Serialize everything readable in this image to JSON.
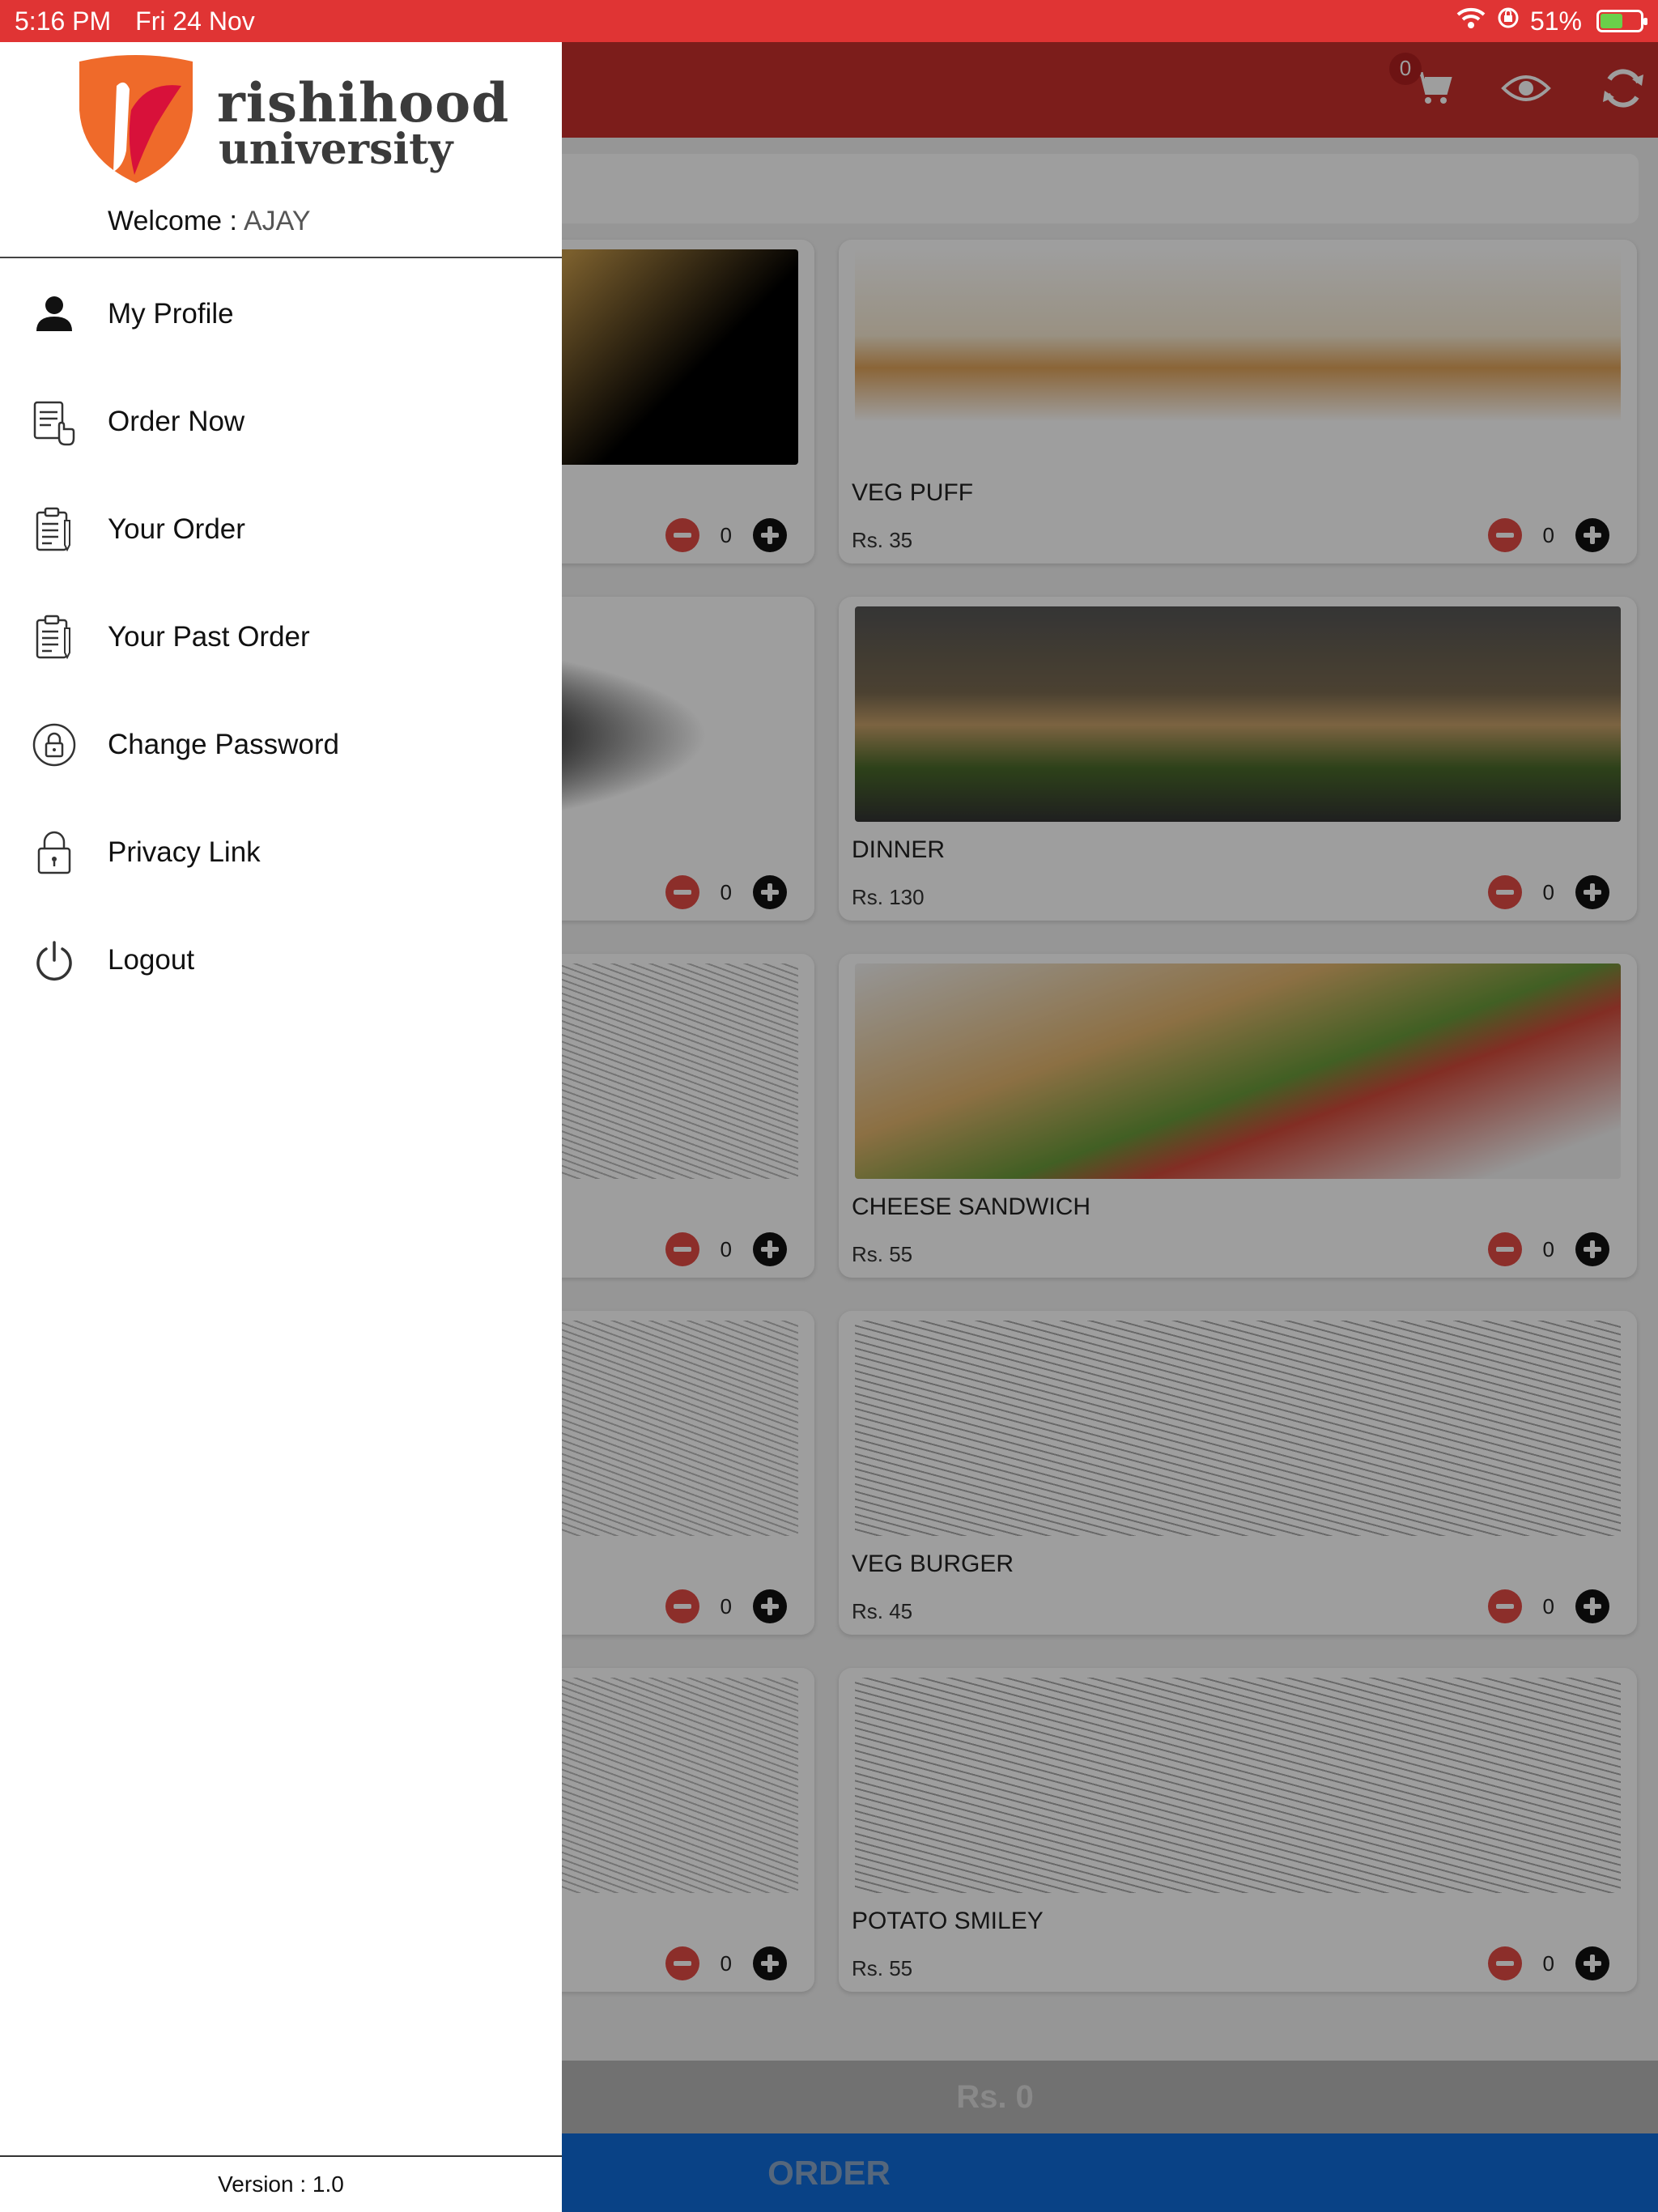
{
  "status_bar": {
    "time": "5:16 PM",
    "date": "Fri 24 Nov",
    "battery": "51%",
    "battery_level": 0.51
  },
  "header": {
    "cart_count": "0",
    "icons": [
      "cart-icon",
      "eye-icon",
      "refresh-icon"
    ]
  },
  "drawer": {
    "brand_line1": "rishihood",
    "brand_line2": "university",
    "welcome_label": "Welcome :",
    "username": "AJAY",
    "items": [
      {
        "label": "My Profile",
        "icon": "person-icon"
      },
      {
        "label": "Order Now",
        "icon": "order-now-icon"
      },
      {
        "label": "Your Order",
        "icon": "clipboard-icon"
      },
      {
        "label": "Your Past Order",
        "icon": "clipboard-history-icon"
      },
      {
        "label": "Change Password",
        "icon": "lock-circle-icon"
      },
      {
        "label": "Privacy Link",
        "icon": "padlock-icon"
      },
      {
        "label": "Logout",
        "icon": "power-icon"
      }
    ],
    "version": "Version : 1.0"
  },
  "products": [
    {
      "name": "",
      "price": "",
      "qty": "0"
    },
    {
      "name": "VEG PUFF",
      "price": "Rs. 35",
      "qty": "0"
    },
    {
      "name": "",
      "price": "",
      "qty": "0"
    },
    {
      "name": "DINNER",
      "price": "Rs. 130",
      "qty": "0"
    },
    {
      "name": "",
      "price": "",
      "qty": "0"
    },
    {
      "name": "CHEESE SANDWICH",
      "price": "Rs. 55",
      "qty": "0"
    },
    {
      "name": "",
      "price": "",
      "qty": "0"
    },
    {
      "name": "VEG BURGER",
      "price": "Rs. 45",
      "qty": "0"
    },
    {
      "name": "",
      "price": "",
      "qty": "0"
    },
    {
      "name": "POTATO SMILEY",
      "price": "Rs. 55",
      "qty": "0"
    }
  ],
  "footer": {
    "total": "Rs. 0",
    "order_label": "ORDER"
  },
  "colors": {
    "status_bar": "#e03434",
    "top_bar": "#c9302c",
    "order_button": "#0f6bd8",
    "minus_button": "#e34b45",
    "plus_button": "#111111"
  }
}
